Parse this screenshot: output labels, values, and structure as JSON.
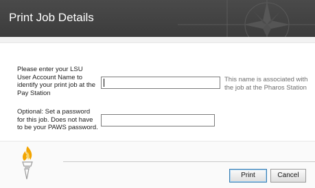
{
  "header": {
    "title": "Print Job Details"
  },
  "form": {
    "username_label": "Please enter your LSU User Account Name to identify your print job at the Pay Station",
    "username_value": "",
    "username_hint": "This name is associated with the job at the Pharos Station",
    "password_label": "Optional: Set a password for this job. Does not have to be your PAWS password.",
    "password_value": ""
  },
  "footer": {
    "print_label": "Print",
    "cancel_label": "Cancel"
  },
  "colors": {
    "header_bg": "#3f3f3f",
    "torch_flame": "#f2a400",
    "button_focus": "#3c7fb1"
  }
}
